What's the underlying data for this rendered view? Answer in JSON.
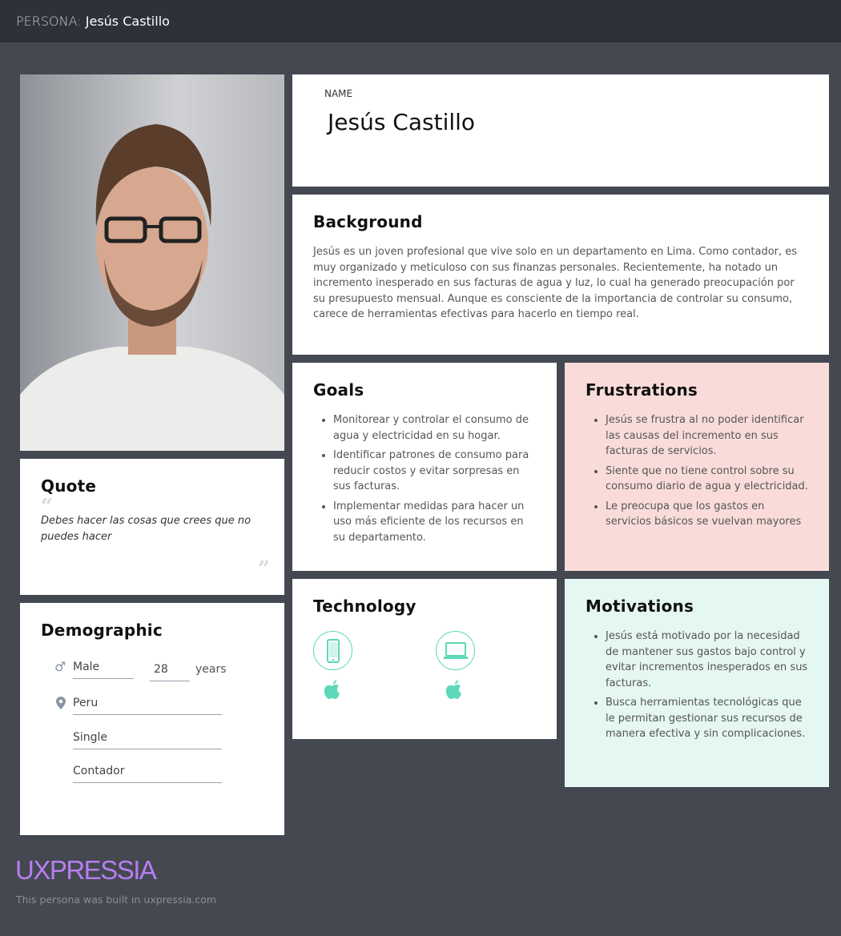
{
  "header": {
    "prefix": "PERSONA:",
    "name": "Jesús Castillo"
  },
  "name_card": {
    "label": "NAME",
    "name": "Jesús Castillo"
  },
  "background": {
    "title": "Background",
    "text": "Jesús es un joven profesional que vive solo en un departamento en Lima. Como contador, es muy organizado y meticuloso con sus finanzas personales. Recientemente, ha notado un incremento inesperado en sus facturas de agua y luz, lo cual ha generado preocupación por su presupuesto mensual. Aunque es consciente de la importancia de controlar su consumo, carece de herramientas efectivas para hacerlo en tiempo real."
  },
  "goals": {
    "title": "Goals",
    "items": [
      "Monitorear y controlar el consumo de agua y electricidad en su hogar.",
      "Identificar patrones de consumo para reducir costos y evitar sorpresas en sus facturas.",
      "Implementar medidas para hacer un uso más eficiente de los recursos en su departamento."
    ]
  },
  "frustrations": {
    "title": "Frustrations",
    "items": [
      "Jesús se frustra al no poder identificar las causas del incremento en sus facturas de servicios.",
      "Siente que no tiene control sobre su consumo diario de agua y electricidad.",
      "Le preocupa que los gastos en servicios básicos se vuelvan mayores"
    ]
  },
  "quote": {
    "title": "Quote",
    "text": "Debes hacer las cosas que crees que no puedes hacer"
  },
  "demographic": {
    "title": "Demographic",
    "gender": "Male",
    "age": "28",
    "age_unit": "years",
    "location": "Peru",
    "status": "Single",
    "occupation": "Contador"
  },
  "technology": {
    "title": "Technology",
    "devices": [
      {
        "icon": "smartphone-icon",
        "os": "apple-icon"
      },
      {
        "icon": "laptop-icon",
        "os": "apple-icon"
      }
    ]
  },
  "motivations": {
    "title": "Motivations",
    "items": [
      "Jesús está motivado por la necesidad de mantener sus gastos bajo control y evitar incrementos inesperados en sus facturas.",
      "Busca herramientas tecnológicas que le permitan gestionar sus recursos de manera efectiva y sin complicaciones."
    ]
  },
  "footer": {
    "logo": "UXPRESSIA",
    "note": "This persona was built in uxpressia.com"
  },
  "colors": {
    "accent": "#5dd8b8",
    "frustrations_bg": "#f9dcd9",
    "motivations_bg": "#e4f7f3",
    "logo": "#b77ef0"
  }
}
